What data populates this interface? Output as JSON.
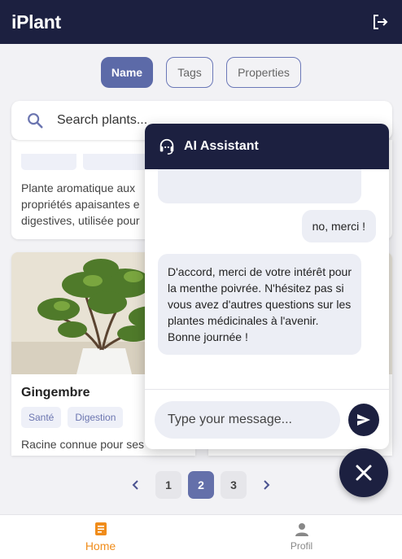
{
  "app": {
    "title": "iPlant"
  },
  "header": {
    "logout_icon": "logout-icon"
  },
  "tabs": [
    {
      "label": "Name",
      "active": true
    },
    {
      "label": "Tags",
      "active": false
    },
    {
      "label": "Properties",
      "active": false
    }
  ],
  "search": {
    "placeholder": "Search plants...",
    "icon": "search-icon"
  },
  "cards": [
    {
      "title": "",
      "tags": [],
      "description_lines": [
        "Plante aromatique aux",
        "propriétés apaisantes e",
        "digestives, utilisée pour"
      ]
    },
    {
      "title": "Gingembre",
      "tags": [
        "Santé",
        "Digestion"
      ],
      "description": "Racine connue pour ses"
    }
  ],
  "pagination": {
    "pages": [
      "1",
      "2",
      "3"
    ],
    "current": "2"
  },
  "bottom_nav": [
    {
      "label": "Home",
      "icon": "notebook-icon",
      "active": true
    },
    {
      "label": "Profil",
      "icon": "person-icon",
      "active": false
    }
  ],
  "chat": {
    "title": "AI Assistant",
    "messages": [
      {
        "from": "user",
        "text": "no, merci !"
      },
      {
        "from": "bot",
        "text": "D'accord, merci de votre intérêt pour la menthe poivrée. N'hésitez pas si vous avez d'autres questions sur les plantes médicinales à l'avenir. Bonne journée !"
      }
    ],
    "input_placeholder": "Type your message..."
  },
  "colors": {
    "navy": "#1c2040",
    "accent": "#5c6aa8",
    "orange": "#f08c1a"
  }
}
